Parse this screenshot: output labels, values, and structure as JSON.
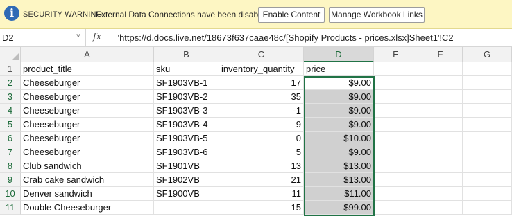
{
  "security_bar": {
    "title": "SECURITY WARNING",
    "message": "External Data Connections have been disabled",
    "enable_button": "Enable Content",
    "manage_button": "Manage Workbook Links",
    "info_glyph": "i"
  },
  "formula_bar": {
    "name_box": "D2",
    "name_caret": "˅",
    "fx_label": "fx",
    "formula": "='https://d.docs.live.net/18673f637caae48c/[Shopify Products - prices.xlsx]Sheet1'!C2"
  },
  "columns": [
    "A",
    "B",
    "C",
    "D",
    "E",
    "F",
    "G"
  ],
  "row_numbers": [
    "1",
    "2",
    "3",
    "4",
    "5",
    "6",
    "7",
    "8",
    "9",
    "10",
    "11"
  ],
  "header_row": {
    "product_title": "product_title",
    "sku": "sku",
    "inventory_quantity": "inventory_quantity",
    "price": "price"
  },
  "rows": [
    {
      "title": "Cheeseburger",
      "sku": "SF1903VB-1",
      "qty": "17",
      "price": "$9.00"
    },
    {
      "title": "Cheeseburger",
      "sku": "SF1903VB-2",
      "qty": "35",
      "price": "$9.00"
    },
    {
      "title": "Cheeseburger",
      "sku": "SF1903VB-3",
      "qty": "-1",
      "price": "$9.00"
    },
    {
      "title": "Cheeseburger",
      "sku": "SF1903VB-4",
      "qty": "9",
      "price": "$9.00"
    },
    {
      "title": "Cheeseburger",
      "sku": "SF1903VB-5",
      "qty": "0",
      "price": "$10.00"
    },
    {
      "title": "Cheeseburger",
      "sku": "SF1903VB-6",
      "qty": "5",
      "price": "$9.00"
    },
    {
      "title": "Club sandwich",
      "sku": "SF1901VB",
      "qty": "13",
      "price": "$13.00"
    },
    {
      "title": "Crab cake sandwich",
      "sku": "SF1902VB",
      "qty": "21",
      "price": "$13.00"
    },
    {
      "title": "Denver sandwich",
      "sku": "SF1900VB",
      "qty": "11",
      "price": "$11.00"
    },
    {
      "title": "Double Cheeseburger",
      "sku": "",
      "qty": "15",
      "price": "$99.00"
    }
  ],
  "colors": {
    "warning_bg": "#fdf6c3",
    "selection": "#217346",
    "selected_fill": "#d0d0d0"
  }
}
